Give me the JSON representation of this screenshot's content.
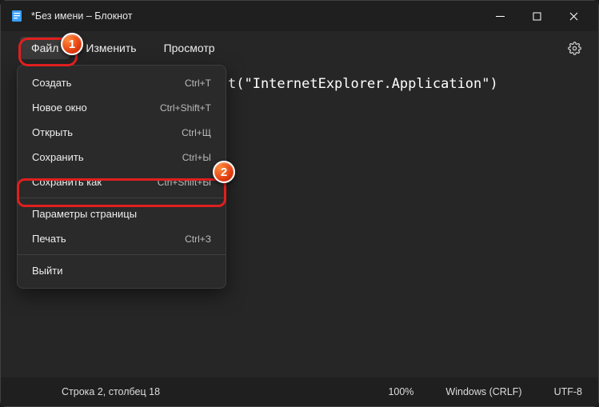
{
  "window": {
    "title": "*Без имени – Блокнот"
  },
  "menubar": {
    "items": [
      {
        "label": "Файл",
        "active": true
      },
      {
        "label": "Изменить",
        "active": false
      },
      {
        "label": "Просмотр",
        "active": false
      }
    ]
  },
  "dropdown": {
    "items": [
      {
        "label": "Создать",
        "shortcut": "Ctrl+T"
      },
      {
        "label": "Новое окно",
        "shortcut": "Ctrl+Shift+T"
      },
      {
        "label": "Открыть",
        "shortcut": "Ctrl+Щ"
      },
      {
        "label": "Сохранить",
        "shortcut": "Ctrl+Ы"
      },
      {
        "label": "Сохранить как",
        "shortcut": "Ctrl+Shift+Ы",
        "highlighted": true
      },
      {
        "sep": true
      },
      {
        "label": "Параметры страницы",
        "shortcut": ""
      },
      {
        "label": "Печать",
        "shortcut": "Ctrl+З"
      },
      {
        "sep": true
      },
      {
        "label": "Выйти",
        "shortcut": ""
      }
    ]
  },
  "content": {
    "visible_text": "t(\"InternetExplorer.Application\")"
  },
  "statusbar": {
    "position": "Строка 2, столбец 18",
    "zoom": "100%",
    "lineending": "Windows (CRLF)",
    "encoding": "UTF-8"
  },
  "annotations": {
    "badge1": "1",
    "badge2": "2"
  }
}
